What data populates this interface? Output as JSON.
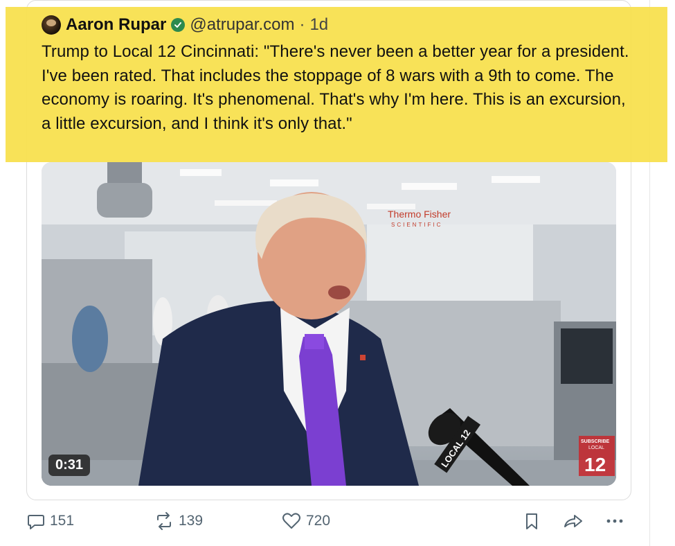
{
  "post": {
    "author": "Aaron Rupar",
    "handle": "@atrupar.com",
    "separator": "·",
    "time": "1d",
    "text": "Trump to Local 12 Cincinnati: \"There's never been a better year for a president. I've been rated. That includes the stoppage of 8 wars with a 9th to come. The economy is roaring. It's phenomenal. That's why I'm here. This is an excursion, a little excursion, and I think it's only that.\"",
    "highlight_color": "#f7df4a"
  },
  "media": {
    "duration": "0:31",
    "signage": "Thermo Fisher",
    "signage_sub": "SCIENTIFIC",
    "mic_flag": "LOCAL 12",
    "bug_subscribe": "SUBSCRIBE",
    "bug_local": "LOCAL",
    "bug_number": "12"
  },
  "actions": {
    "replies": "151",
    "reposts": "139",
    "likes": "720"
  },
  "icons": {
    "reply": "speech-bubble-icon",
    "repost": "repost-arrows-icon",
    "like": "heart-icon",
    "bookmark": "bookmark-icon",
    "share": "share-arrow-icon",
    "more": "ellipsis-icon"
  }
}
